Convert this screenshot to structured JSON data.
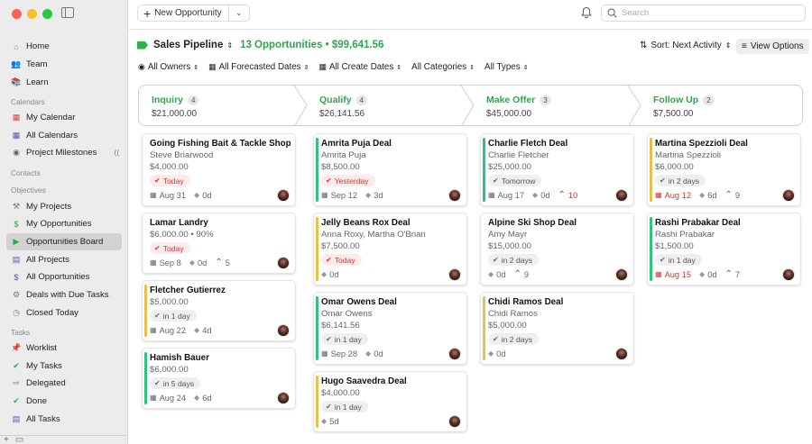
{
  "sidebar": {
    "traffic_colors": [
      "#fe5f57",
      "#febc2e",
      "#28c840"
    ],
    "items": [
      {
        "type": "item",
        "label": "Home",
        "icon": "home-icon",
        "glyph": "⌂",
        "color": "#888"
      },
      {
        "type": "item",
        "label": "Team",
        "icon": "team-icon",
        "glyph": "👥",
        "color": "#5a5ad6"
      },
      {
        "type": "item",
        "label": "Learn",
        "icon": "books-icon",
        "glyph": "📚",
        "color": "#c55"
      },
      {
        "type": "section",
        "label": "Calendars"
      },
      {
        "type": "item",
        "label": "My Calendar",
        "icon": "calendar-icon",
        "glyph": "▦",
        "color": "#d44"
      },
      {
        "type": "item",
        "label": "All Calendars",
        "icon": "calendars-icon",
        "glyph": "▦",
        "color": "#55a"
      },
      {
        "type": "item",
        "label": "Project Milestones",
        "icon": "milestones-icon",
        "glyph": "◉",
        "color": "#666",
        "sync": true
      },
      {
        "type": "section",
        "label": "Contacts"
      },
      {
        "type": "section",
        "label": "Objectives"
      },
      {
        "type": "item",
        "label": "My Projects",
        "icon": "hammer-icon",
        "glyph": "⚒",
        "color": "#777"
      },
      {
        "type": "item",
        "label": "My Opportunities",
        "icon": "dollar-icon",
        "glyph": "$",
        "color": "#2aa84a"
      },
      {
        "type": "item",
        "label": "Opportunities Board",
        "icon": "pipeline-icon",
        "glyph": "▶",
        "color": "#2aa84a",
        "active": true
      },
      {
        "type": "item",
        "label": "All Projects",
        "icon": "projects-icon",
        "glyph": "▤",
        "color": "#55a"
      },
      {
        "type": "item",
        "label": "All Opportunities",
        "icon": "opportunities-icon",
        "glyph": "$",
        "color": "#55a"
      },
      {
        "type": "item",
        "label": "Deals with Due Tasks",
        "icon": "deals-icon",
        "glyph": "⚙",
        "color": "#777"
      },
      {
        "type": "item",
        "label": "Closed Today",
        "icon": "closed-icon",
        "glyph": "◷",
        "color": "#777"
      },
      {
        "type": "section",
        "label": "Tasks"
      },
      {
        "type": "item",
        "label": "Worklist",
        "icon": "pin-icon",
        "glyph": "📌",
        "color": "#c84"
      },
      {
        "type": "item",
        "label": "My Tasks",
        "icon": "check-icon",
        "glyph": "✔",
        "color": "#2aa84a"
      },
      {
        "type": "item",
        "label": "Delegated",
        "icon": "delegated-icon",
        "glyph": "⇨",
        "color": "#777"
      },
      {
        "type": "item",
        "label": "Done",
        "icon": "done-icon",
        "glyph": "✔",
        "color": "#2aa84a"
      },
      {
        "type": "item",
        "label": "All Tasks",
        "icon": "all-tasks-icon",
        "glyph": "▤",
        "color": "#55a"
      }
    ],
    "bottom": {
      "add": "+",
      "menu": "▭"
    }
  },
  "toolbar": {
    "new_label": "New Opportunity",
    "search_placeholder": "Search"
  },
  "header": {
    "title": "Sales Pipeline",
    "summary": "13 Opportunities • $99,641.56",
    "sort_label": "Sort: Next Activity",
    "view_label": "View Options"
  },
  "filters": [
    "All Owners",
    "All Forecasted Dates",
    "All Create Dates",
    "All Categories",
    "All Types"
  ],
  "stages": [
    {
      "name": "Inquiry",
      "count": "4",
      "amount": "$21,000.00"
    },
    {
      "name": "Qualify",
      "count": "4",
      "amount": "$26,141.56"
    },
    {
      "name": "Make Offer",
      "count": "3",
      "amount": "$45,000.00"
    },
    {
      "name": "Follow Up",
      "count": "2",
      "amount": "$7,500.00"
    }
  ],
  "columns": [
    [
      {
        "title": "Going Fishing Bait & Tackle Shop",
        "contact": "Steve Briarwood",
        "amount": "$4,000.00",
        "chip": "Today",
        "chip_style": "red",
        "date": "Aug 31",
        "date_red": false,
        "notes": "0d",
        "extra": "",
        "bar": ""
      },
      {
        "title": "Lamar Landry",
        "contact": "",
        "amount": "$6,000.00 • 90%",
        "chip": "Today",
        "chip_style": "red",
        "date": "Sep 8",
        "date_red": false,
        "notes": "0d",
        "extra": "5",
        "bar": ""
      },
      {
        "title": "Fletcher Gutierrez",
        "contact": "",
        "amount": "$5,000.00",
        "chip": "in 1 day",
        "chip_style": "grey",
        "date": "Aug 22",
        "date_red": false,
        "notes": "4d",
        "extra": "",
        "bar": "y"
      },
      {
        "title": "Hamish Bauer",
        "contact": "",
        "amount": "$6,000.00",
        "chip": "in 5 days",
        "chip_style": "grey",
        "date": "Aug 24",
        "date_red": false,
        "notes": "6d",
        "extra": "",
        "bar": "g"
      }
    ],
    [
      {
        "title": "Amrita Puja Deal",
        "contact": "Amrita Puja",
        "amount": "$8,500.00",
        "chip": "Yesterday",
        "chip_style": "red",
        "date": "Sep 12",
        "date_red": false,
        "notes": "3d",
        "extra": "",
        "bar": "g"
      },
      {
        "title": "Jelly Beans Rox Deal",
        "contact": "Anna Roxy, Martha O'Brian",
        "amount": "$7,500.00",
        "chip": "Today",
        "chip_style": "red",
        "date": "",
        "date_red": false,
        "notes": "0d",
        "extra": "",
        "bar": "y"
      },
      {
        "title": "Omar Owens Deal",
        "contact": "Omar Owens",
        "amount": "$6,141.56",
        "chip": "in 1 day",
        "chip_style": "grey",
        "date": "Sep 28",
        "date_red": false,
        "notes": "0d",
        "extra": "",
        "bar": "g"
      },
      {
        "title": "Hugo Saavedra Deal",
        "contact": "",
        "amount": "$4,000.00",
        "chip": "in 1 day",
        "chip_style": "grey",
        "date": "",
        "date_red": false,
        "notes": "5d",
        "extra": "",
        "bar": "y"
      }
    ],
    [
      {
        "title": "Charlie Fletch Deal",
        "contact": "Charlie Fletcher",
        "amount": "$25,000.00",
        "chip": "Tomorrow",
        "chip_style": "grey",
        "date": "Aug 17",
        "date_red": false,
        "notes": "0d",
        "extra": "10",
        "extra_red": true,
        "bar": "g"
      },
      {
        "title": "Alpine Ski Shop Deal",
        "contact": "Amy Mayr",
        "amount": "$15,000.00",
        "chip": "in 2 days",
        "chip_style": "grey",
        "date": "",
        "date_red": false,
        "notes": "0d",
        "extra": "9",
        "bar": ""
      },
      {
        "title": "Chidi Ramos Deal",
        "contact": "Chidi Ramos",
        "amount": "$5,000.00",
        "chip": "in 2 days",
        "chip_style": "grey",
        "date": "",
        "date_red": false,
        "notes": "0d",
        "extra": "",
        "bar": "y"
      }
    ],
    [
      {
        "title": "Martina Spezzioli Deal",
        "contact": "Martina Spezzioli",
        "amount": "$6,000.00",
        "chip": "in 2 days",
        "chip_style": "grey",
        "date": "Aug 12",
        "date_red": true,
        "notes": "6d",
        "extra": "9",
        "bar": "y"
      },
      {
        "title": "Rashi Prabakar Deal",
        "contact": "Rashi Prabakar",
        "amount": "$1,500.00",
        "chip": "in 1 day",
        "chip_style": "grey",
        "date": "Aug 15",
        "date_red": true,
        "notes": "0d",
        "extra": "7",
        "bar": "g"
      }
    ]
  ]
}
